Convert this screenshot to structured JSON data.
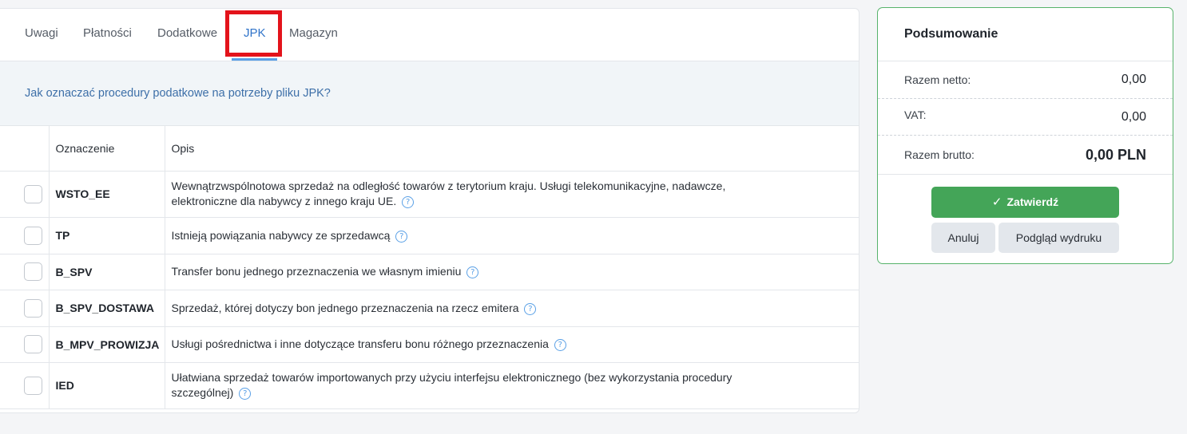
{
  "tabs": [
    {
      "label": "Uwagi"
    },
    {
      "label": "Płatności"
    },
    {
      "label": "Dodatkowe"
    },
    {
      "label": "JPK"
    },
    {
      "label": "Magazyn"
    }
  ],
  "active_tab": "JPK",
  "info_link": "Jak oznaczać procedury podatkowe na potrzeby pliku JPK?",
  "table": {
    "headers": {
      "code": "Oznaczenie",
      "desc": "Opis"
    },
    "rows": [
      {
        "code": "WSTO_EE",
        "desc": "Wewnątrzwspólnotowa sprzedaż na odległość towarów z terytorium kraju. Usługi telekomunikacyjne, nadawcze, elektroniczne dla nabywcy z innego kraju UE.",
        "checked": false
      },
      {
        "code": "TP",
        "desc": "Istnieją powiązania nabywcy ze sprzedawcą",
        "checked": false
      },
      {
        "code": "B_SPV",
        "desc": "Transfer bonu jednego przeznaczenia we własnym imieniu",
        "checked": false
      },
      {
        "code": "B_SPV_DOSTAWA",
        "desc": "Sprzedaż, której dotyczy bon jednego przeznaczenia na rzecz emitera",
        "checked": false
      },
      {
        "code": "B_MPV_PROWIZJA",
        "desc": "Usługi pośrednictwa i inne dotyczące transferu bonu różnego przeznaczenia",
        "checked": false
      },
      {
        "code": "IED",
        "desc": "Ułatwiana sprzedaż towarów importowanych przy użyciu interfejsu elektronicznego (bez wykorzystania procedury szczególnej)",
        "checked": false
      }
    ],
    "help_glyph": "?"
  },
  "summary": {
    "title": "Podsumowanie",
    "netto_label": "Razem netto:",
    "netto_value": "0,00",
    "vat_label": "VAT:",
    "vat_value": "0,00",
    "brutto_label": "Razem brutto:",
    "brutto_value": "0,00 PLN",
    "confirm_label": "Zatwierdź",
    "cancel_label": "Anuluj",
    "preview_label": "Podgląd wydruku"
  },
  "colors": {
    "accent": "#2f73c9",
    "confirm": "#44a558",
    "highlight": "#e3131b"
  },
  "icons": {
    "help": "question-circle-icon",
    "confirm": "check-icon"
  }
}
